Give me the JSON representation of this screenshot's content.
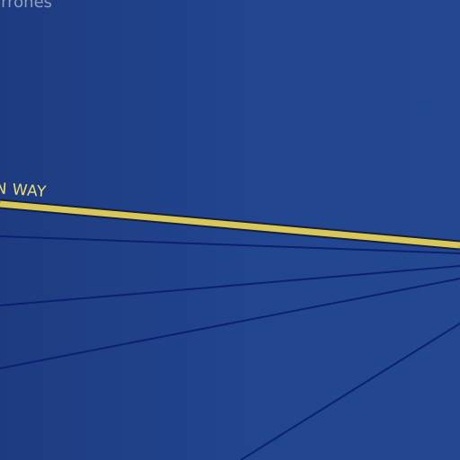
{
  "map": {
    "background_color": "#1f3f86",
    "place_label": "rrrones",
    "road": {
      "label": "N WAY",
      "fill_color": "#d8c75a",
      "casing_color": "#17203a"
    },
    "thin_line_color": "#0d1f73"
  }
}
